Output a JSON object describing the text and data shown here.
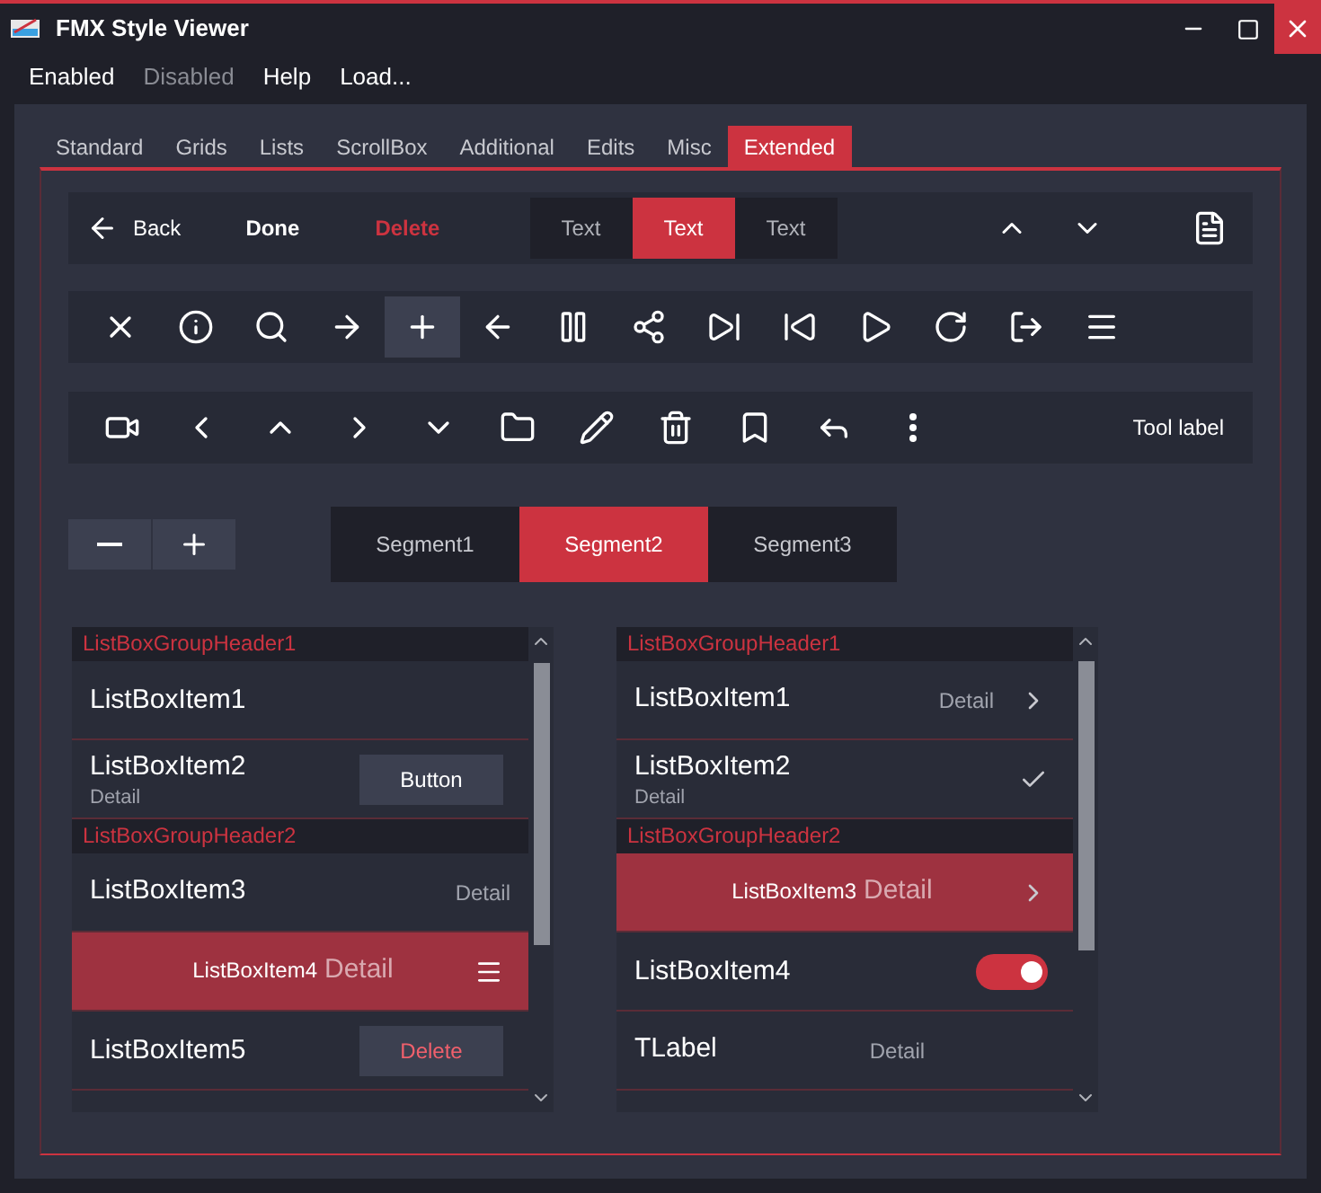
{
  "window": {
    "title": "FMX Style Viewer"
  },
  "menu": [
    {
      "label": "Enabled",
      "disabled": false
    },
    {
      "label": "Disabled",
      "disabled": true
    },
    {
      "label": "Help",
      "disabled": false
    },
    {
      "label": "Load...",
      "disabled": false
    }
  ],
  "tabs": [
    {
      "label": "Standard",
      "selected": false
    },
    {
      "label": "Grids",
      "selected": false
    },
    {
      "label": "Lists",
      "selected": false
    },
    {
      "label": "ScrollBox",
      "selected": false
    },
    {
      "label": "Additional",
      "selected": false
    },
    {
      "label": "Edits",
      "selected": false
    },
    {
      "label": "Misc",
      "selected": false
    },
    {
      "label": "Extended",
      "selected": true
    }
  ],
  "toolbar1": {
    "back": "Back",
    "done": "Done",
    "delete": "Delete",
    "segments": [
      {
        "label": "Text",
        "selected": false
      },
      {
        "label": "Text",
        "selected": true
      },
      {
        "label": "Text",
        "selected": false
      }
    ]
  },
  "toolbar2": [
    {
      "selected": false
    },
    {
      "selected": false
    },
    {
      "selected": false
    },
    {
      "selected": false
    },
    {
      "selected": true
    },
    {
      "selected": false
    },
    {
      "selected": false
    },
    {
      "selected": false
    },
    {
      "selected": false
    },
    {
      "selected": false
    },
    {
      "selected": false
    },
    {
      "selected": false
    },
    {
      "selected": false
    },
    {
      "selected": false
    }
  ],
  "toolbar3": {
    "label": "Tool label"
  },
  "segments": [
    {
      "label": "Segment1",
      "selected": false
    },
    {
      "label": "Segment2",
      "selected": true
    },
    {
      "label": "Segment3",
      "selected": false
    }
  ],
  "lists": [
    {
      "items": [
        {
          "kind": "header",
          "text": "ListBoxGroupHeader1"
        },
        {
          "kind": "plain",
          "text": "ListBoxItem1",
          "selected": false
        },
        {
          "kind": "subtitle",
          "text": "ListBoxItem2",
          "detail": "Detail",
          "selected": false,
          "accessory": {
            "kind": "button",
            "label": "Button"
          }
        },
        {
          "kind": "header",
          "text": "ListBoxGroupHeader2"
        },
        {
          "kind": "right_detail",
          "text": "ListBoxItem3",
          "detail": "Detail",
          "selected": false
        },
        {
          "kind": "inline_detail",
          "text": "ListBoxItem4",
          "detail": "Detail",
          "selected": true,
          "accessory": {
            "kind": "menu"
          }
        },
        {
          "kind": "plain",
          "text": "ListBoxItem5",
          "selected": false,
          "accessory": {
            "kind": "delete_button",
            "label": "Delete"
          }
        }
      ]
    },
    {
      "items": [
        {
          "kind": "header",
          "text": "ListBoxGroupHeader1"
        },
        {
          "kind": "right_detail",
          "text": "ListBoxItem1",
          "detail": "Detail",
          "selected": false,
          "accessory": {
            "kind": "chevron"
          }
        },
        {
          "kind": "subtitle",
          "text": "ListBoxItem2",
          "detail": "Detail",
          "selected": false,
          "accessory": {
            "kind": "check"
          }
        },
        {
          "kind": "header",
          "text": "ListBoxGroupHeader2"
        },
        {
          "kind": "inline_detail",
          "text": "ListBoxItem3",
          "detail": "Detail",
          "selected": true,
          "accessory": {
            "kind": "chevron"
          }
        },
        {
          "kind": "plain",
          "text": "ListBoxItem4",
          "selected": false,
          "accessory": {
            "kind": "switch",
            "on": true
          }
        },
        {
          "kind": "label_detail",
          "text": "TLabel",
          "detail": "Detail",
          "selected": false
        }
      ]
    }
  ]
}
